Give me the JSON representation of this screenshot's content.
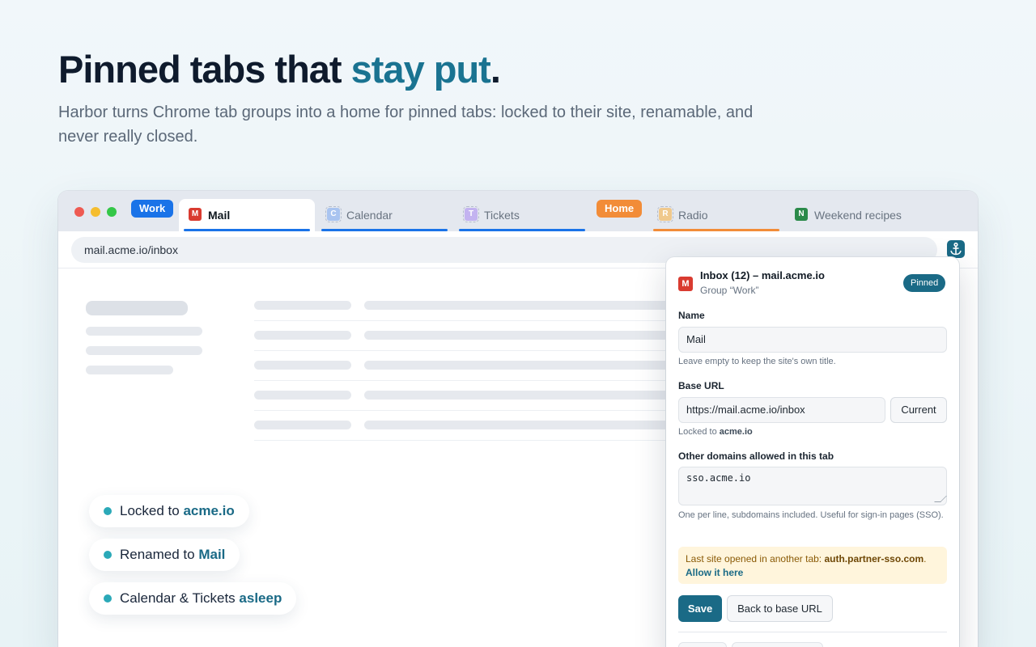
{
  "hero": {
    "title_start": "Pinned tabs that ",
    "title_accent": "stay put",
    "title_end": ".",
    "subtitle": "Harbor turns Chrome tab groups into a home for pinned tabs: locked to their site, renamable, and never really closed."
  },
  "colors": {
    "accent": "#1a7391",
    "work_group": "#1a73e8",
    "home_group": "#f28c38"
  },
  "tabstrip": {
    "groups": [
      {
        "label": "Work",
        "color": "#1a73e8"
      },
      {
        "label": "Home",
        "color": "#f28c38"
      }
    ],
    "tabs": [
      {
        "favicon": "M",
        "label": "Mail",
        "active": true
      },
      {
        "favicon": "C",
        "label": "Calendar",
        "asleep": true
      },
      {
        "favicon": "T",
        "label": "Tickets",
        "asleep": true
      },
      {
        "favicon": "R",
        "label": "Radio",
        "asleep": true
      },
      {
        "favicon": "N",
        "label": "Weekend recipes"
      }
    ]
  },
  "toolbar": {
    "url": "mail.acme.io/inbox",
    "extension_icon": "anchor-icon"
  },
  "features": [
    {
      "text": "Locked to ",
      "highlight": "acme.io"
    },
    {
      "text": "Renamed to ",
      "highlight": "Mail"
    },
    {
      "text": "Calendar & Tickets ",
      "highlight": "asleep"
    }
  ],
  "popup": {
    "favicon": "M",
    "title": "Inbox (12) – mail.acme.io",
    "group": "Group “Work”",
    "badge": "Pinned",
    "name_label": "Name",
    "name_value": "Mail",
    "name_help": "Leave empty to keep the site's own title.",
    "base_url_label": "Base URL",
    "base_url_value": "https://mail.acme.io/inbox",
    "current_button": "Current",
    "locked_prefix": "Locked to ",
    "locked_domain": "acme.io",
    "other_domains_label": "Other domains allowed in this tab",
    "other_domains_value": "sso.acme.io",
    "other_domains_help": "One per line, subdomains included. Useful for sign-in pages (SSO).",
    "warning_prefix": "Last site opened in another tab: ",
    "warning_domain": "auth.partner-sso.com",
    "warning_sep": ". ",
    "warning_link": "Allow it here",
    "save_button": "Save",
    "back_button": "Back to base URL"
  }
}
